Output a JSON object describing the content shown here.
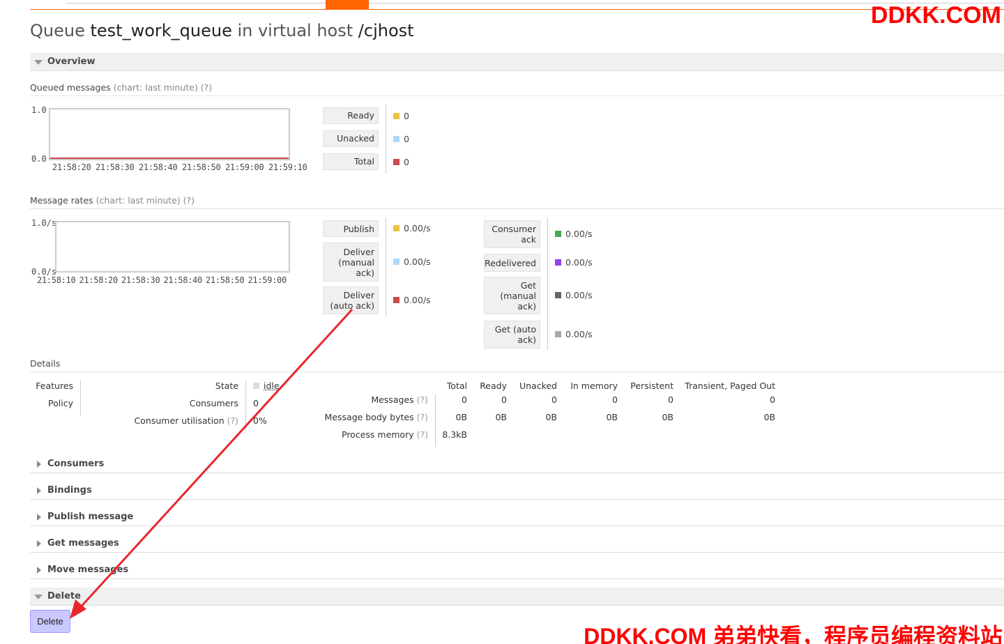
{
  "watermark_top": "DDKK.COM",
  "watermark_bottom": "DDKK.COM 弟弟快看，程序员编程资料站",
  "title": {
    "prefix": "Queue ",
    "queue": "test_work_queue",
    "mid": " in virtual host ",
    "vhost": "/cjhost"
  },
  "overview_label": "Overview",
  "queued": {
    "heading": "Queued messages",
    "muted": "(chart: last minute) (?)",
    "y_top": "1.0",
    "y_bottom": "0.0",
    "x_ticks": [
      "21:58:20",
      "21:58:30",
      "21:58:40",
      "21:58:50",
      "21:59:00",
      "21:59:10"
    ],
    "legend": [
      {
        "label": "Ready",
        "value": "0",
        "color": "#edc240"
      },
      {
        "label": "Unacked",
        "value": "0",
        "color": "#afd8f8"
      },
      {
        "label": "Total",
        "value": "0",
        "color": "#cb4b4b"
      }
    ]
  },
  "rates": {
    "heading": "Message rates",
    "muted": "(chart: last minute) (?)",
    "y_top": "1.0/s",
    "y_bottom": "0.0/s",
    "x_ticks": [
      "21:58:10",
      "21:58:20",
      "21:58:30",
      "21:58:40",
      "21:58:50",
      "21:59:00"
    ],
    "left": [
      {
        "label": "Publish",
        "value": "0.00/s",
        "color": "#edc240"
      },
      {
        "label": "Deliver (manual ack)",
        "value": "0.00/s",
        "color": "#afd8f8"
      },
      {
        "label": "Deliver (auto ack)",
        "value": "0.00/s",
        "color": "#cb4b4b"
      }
    ],
    "right": [
      {
        "label": "Consumer ack",
        "value": "0.00/s",
        "color": "#4da74d"
      },
      {
        "label": "Redelivered",
        "value": "0.00/s",
        "color": "#9440ed"
      },
      {
        "label": "Get (manual ack)",
        "value": "0.00/s",
        "color": "#666666"
      },
      {
        "label": "Get (auto ack)",
        "value": "0.00/s",
        "color": "#aaaaaa"
      }
    ]
  },
  "details": {
    "heading": "Details",
    "features_label": "Features",
    "policy_label": "Policy",
    "state_label": "State",
    "state_value": "idle",
    "consumers_label": "Consumers",
    "consumers_value": "0",
    "utilisation_label": "Consumer utilisation",
    "utilisation_q": "(?)",
    "utilisation_value": "0%",
    "columns": [
      "Total",
      "Ready",
      "Unacked",
      "In memory",
      "Persistent",
      "Transient, Paged Out"
    ],
    "rows": [
      {
        "label": "Messages",
        "q": "(?)",
        "values": [
          "0",
          "0",
          "0",
          "0",
          "0",
          "0"
        ]
      },
      {
        "label": "Message body bytes",
        "q": "(?)",
        "values": [
          "0B",
          "0B",
          "0B",
          "0B",
          "0B",
          "0B"
        ]
      },
      {
        "label": "Process memory",
        "q": "(?)",
        "values": [
          "8.3kB"
        ]
      }
    ]
  },
  "sections": [
    "Consumers",
    "Bindings",
    "Publish message",
    "Get messages",
    "Move messages"
  ],
  "delete_section": "Delete",
  "delete_button": "Delete"
}
